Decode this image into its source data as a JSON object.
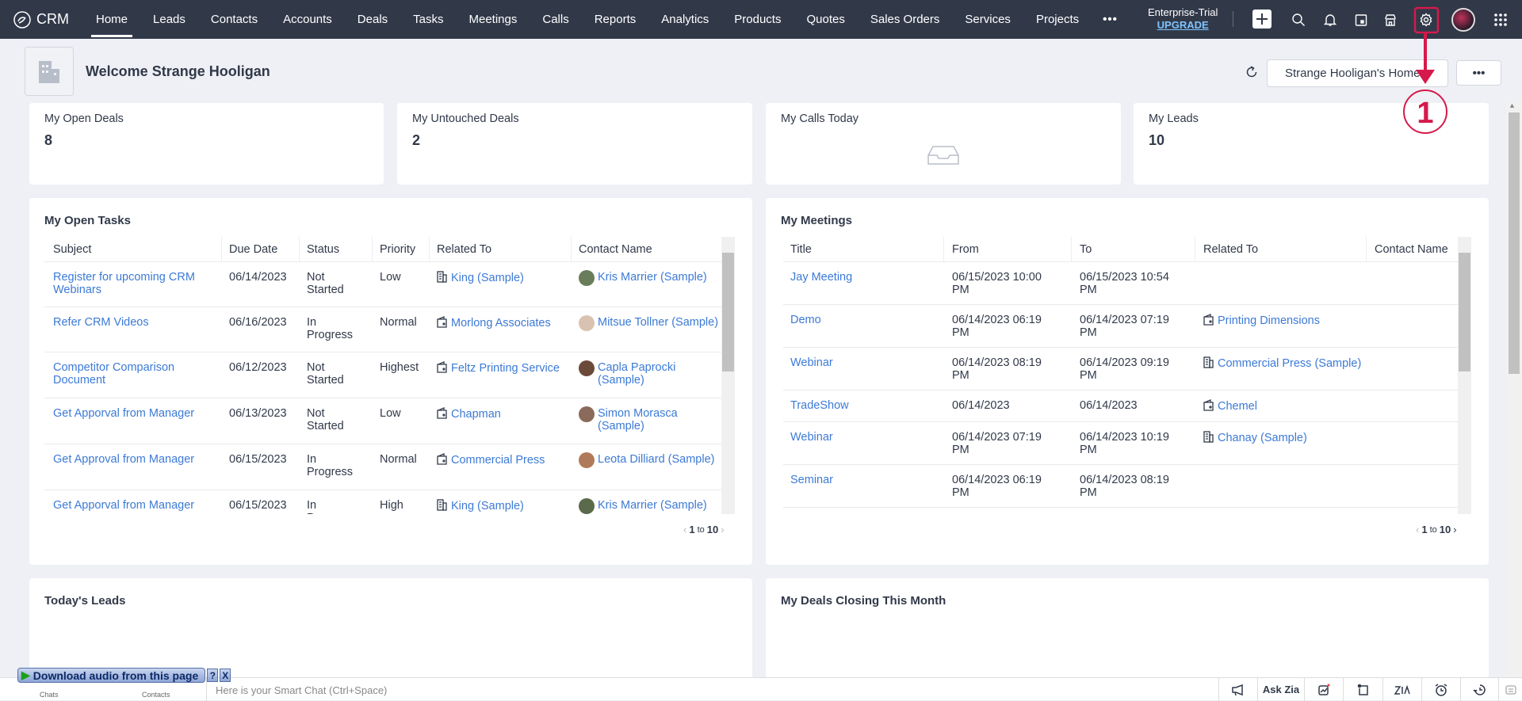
{
  "nav": {
    "brand": "CRM",
    "items": [
      "Home",
      "Leads",
      "Contacts",
      "Accounts",
      "Deals",
      "Tasks",
      "Meetings",
      "Calls",
      "Reports",
      "Analytics",
      "Products",
      "Quotes",
      "Sales Orders",
      "Services",
      "Projects"
    ],
    "active": "Home",
    "more": "•••",
    "edition": "Enterprise-Trial",
    "upgrade": "UPGRADE"
  },
  "header": {
    "welcome": "Welcome Strange Hooligan",
    "home_selector": "Strange Hooligan's Home",
    "more": "•••"
  },
  "stats": [
    {
      "label": "My Open Deals",
      "value": "8"
    },
    {
      "label": "My Untouched Deals",
      "value": "2"
    },
    {
      "label": "My Calls Today",
      "value": null,
      "empty_icon": "inbox-icon"
    },
    {
      "label": "My Leads",
      "value": "10"
    }
  ],
  "tasks": {
    "title": "My Open Tasks",
    "columns": [
      "Subject",
      "Due Date",
      "Status",
      "Priority",
      "Related To",
      "Contact Name"
    ],
    "rows": [
      {
        "subject": "Register for upcoming CRM Webinars",
        "due": "06/14/2023",
        "status": "Not Started",
        "priority": "Low",
        "related": "King (Sample)",
        "related_icon": "account",
        "contact": "Kris Marrier (Sample)"
      },
      {
        "subject": "Refer CRM Videos",
        "due": "06/16/2023",
        "status": "In Progress",
        "priority": "Normal",
        "related": "Morlong Associates",
        "related_icon": "deal",
        "contact": "Mitsue Tollner (Sample)"
      },
      {
        "subject": "Competitor Comparison Document",
        "due": "06/12/2023",
        "status": "Not Started",
        "priority": "Highest",
        "related": "Feltz Printing Service",
        "related_icon": "deal",
        "contact": "Capla Paprocki (Sample)"
      },
      {
        "subject": "Get Apporval from Manager",
        "due": "06/13/2023",
        "status": "Not Started",
        "priority": "Low",
        "related": "Chapman",
        "related_icon": "deal",
        "contact": "Simon Morasca (Sample)"
      },
      {
        "subject": "Get Approval from Manager",
        "due": "06/15/2023",
        "status": "In Progress",
        "priority": "Normal",
        "related": "Commercial Press",
        "related_icon": "deal",
        "contact": "Leota Dilliard (Sample)"
      },
      {
        "subject": "Get Apporval from Manager",
        "due": "06/15/2023",
        "status": "In Progress",
        "priority": "High",
        "related": "King (Sample)",
        "related_icon": "account",
        "contact": "Kris Marrier (Sample)"
      }
    ],
    "pager": {
      "from": "1",
      "sep": "to",
      "to": "10"
    }
  },
  "meetings": {
    "title": "My Meetings",
    "columns": [
      "Title",
      "From",
      "To",
      "Related To",
      "Contact Name"
    ],
    "rows": [
      {
        "title": "Jay Meeting",
        "from": "06/15/2023 10:00 PM",
        "to": "06/15/2023 10:54 PM",
        "related": "",
        "related_icon": ""
      },
      {
        "title": "Demo",
        "from": "06/14/2023 06:19 PM",
        "to": "06/14/2023 07:19 PM",
        "related": "Printing Dimensions",
        "related_icon": "deal"
      },
      {
        "title": "Webinar",
        "from": "06/14/2023 08:19 PM",
        "to": "06/14/2023 09:19 PM",
        "related": "Commercial Press (Sample)",
        "related_icon": "account"
      },
      {
        "title": "TradeShow",
        "from": "06/14/2023",
        "to": "06/14/2023",
        "related": "Chemel",
        "related_icon": "deal"
      },
      {
        "title": "Webinar",
        "from": "06/14/2023 07:19 PM",
        "to": "06/14/2023 10:19 PM",
        "related": "Chanay (Sample)",
        "related_icon": "account"
      },
      {
        "title": "Seminar",
        "from": "06/14/2023 06:19 PM",
        "to": "06/14/2023 08:19 PM",
        "related": "",
        "related_icon": ""
      }
    ],
    "pager": {
      "from": "1",
      "sep": "to",
      "to": "10"
    }
  },
  "lower_panels": [
    "Today's Leads",
    "My Deals Closing This Month"
  ],
  "bottom": {
    "chats": "Chats",
    "contacts": "Contacts",
    "smart_chat_placeholder": "Here is your Smart Chat (Ctrl+Space)",
    "ask_zia": "Ask Zia"
  },
  "overlay": {
    "download_audio": "Download audio from this page",
    "help": "?",
    "close": "X"
  },
  "annotation": {
    "step": "1",
    "color": "#d6194b"
  },
  "colors": {
    "nav_bg": "#313949",
    "link": "#3c7ad6",
    "accent_annotation": "#d6194b"
  }
}
